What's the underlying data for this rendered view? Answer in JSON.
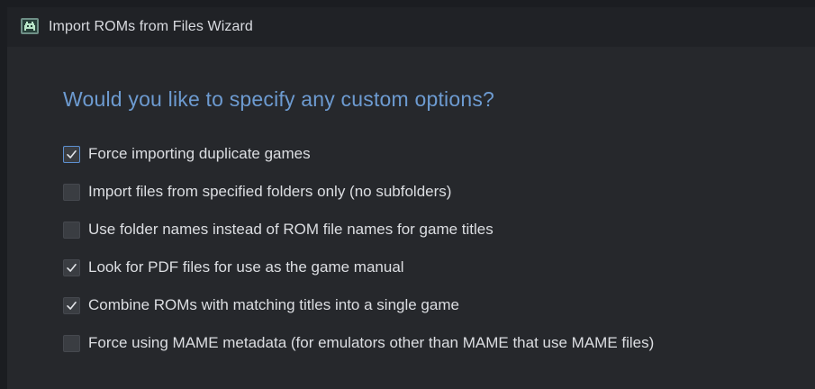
{
  "window": {
    "title": "Import ROMs from Files Wizard"
  },
  "heading": "Would you like to specify any custom options?",
  "options": [
    {
      "label": "Force importing duplicate games",
      "checked": true
    },
    {
      "label": "Import files from specified folders only (no subfolders)",
      "checked": false
    },
    {
      "label": "Use folder names instead of ROM file names for game titles",
      "checked": false
    },
    {
      "label": "Look for PDF files for use as the game manual",
      "checked": true
    },
    {
      "label": "Combine ROMs with matching titles into a single game",
      "checked": true
    },
    {
      "label": "Force using MAME metadata (for emulators other than MAME that use MAME files)",
      "checked": false
    }
  ],
  "icons": {
    "app": "space-invader-icon",
    "check": "checkmark-icon"
  },
  "colors": {
    "heading": "#6d9bd1",
    "focus_border": "#5d8fd0",
    "checkbox_bg": "#3a3d42",
    "text": "#dcdee2",
    "background": "#26282c"
  }
}
